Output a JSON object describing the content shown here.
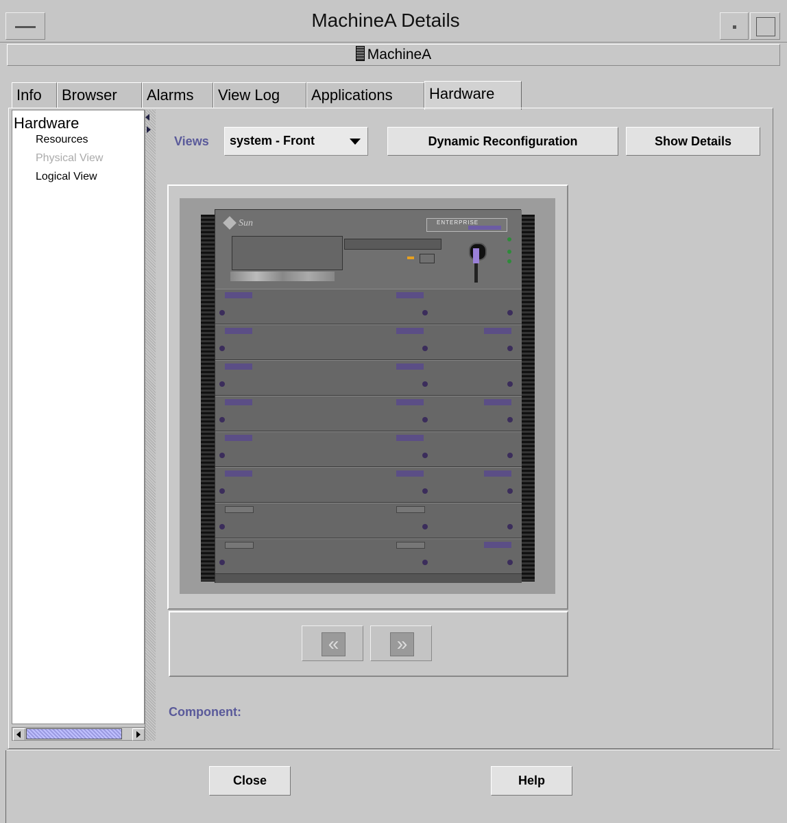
{
  "window": {
    "title": "MachineA Details"
  },
  "machine": {
    "name": "MachineA"
  },
  "tabs": [
    {
      "label": "Info"
    },
    {
      "label": "Browser"
    },
    {
      "label": "Alarms"
    },
    {
      "label": "View Log"
    },
    {
      "label": "Applications"
    },
    {
      "label": "Hardware",
      "active": true
    }
  ],
  "tree": {
    "root": "Hardware",
    "items": [
      {
        "label": "Resources"
      },
      {
        "label": "Physical View",
        "disabled": true
      },
      {
        "label": "Logical View"
      }
    ]
  },
  "toolbar": {
    "views_label": "Views",
    "views_selected": "system - Front",
    "dynamic_reconfig": "Dynamic Reconfiguration",
    "show_details": "Show Details"
  },
  "image": {
    "brand": "Sun",
    "model_badge": "ENTERPRISE"
  },
  "component": {
    "label": "Component:"
  },
  "footer": {
    "close": "Close",
    "help": "Help"
  },
  "colors": {
    "label_blue": "#5a5a9a",
    "accent_purple": "#5b4e86"
  }
}
